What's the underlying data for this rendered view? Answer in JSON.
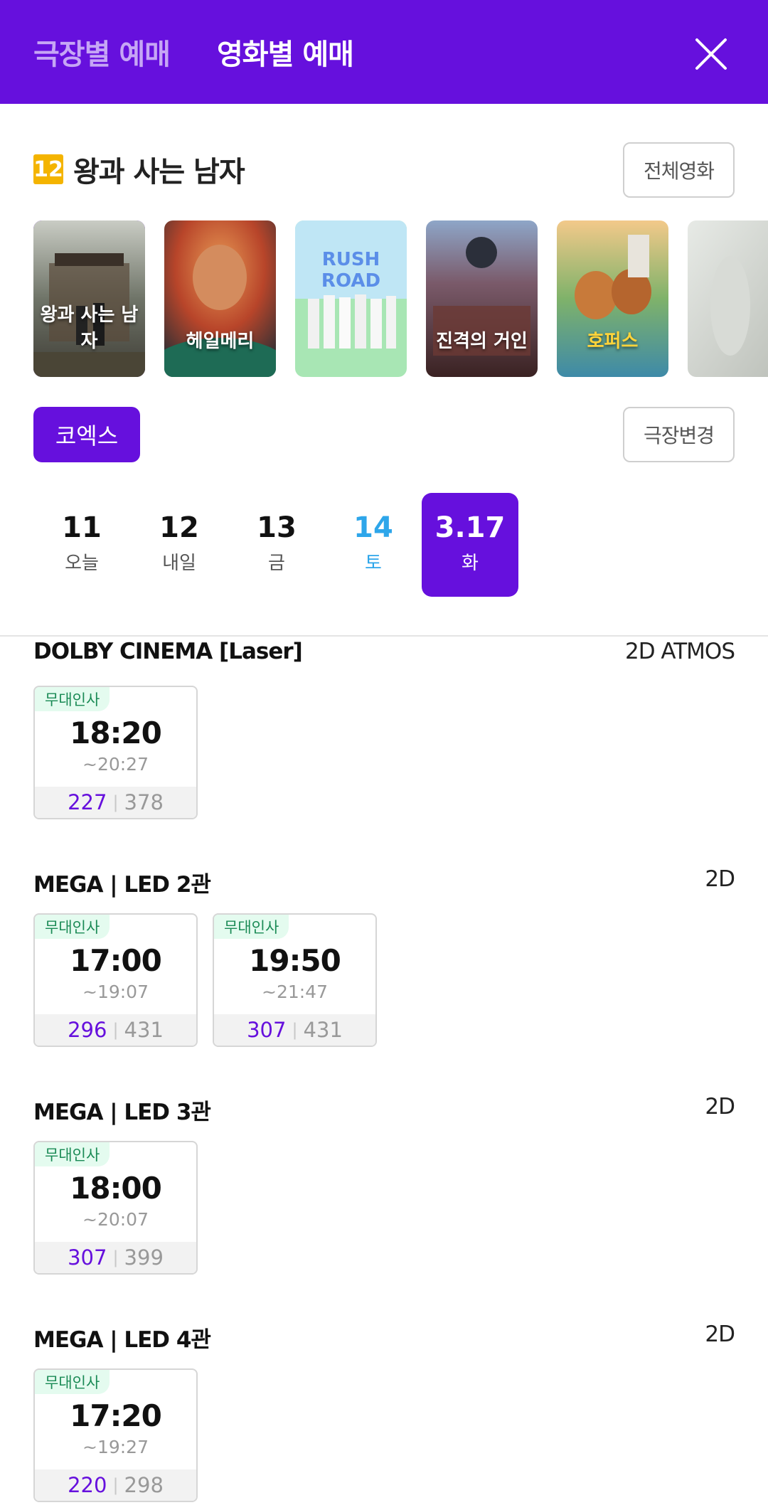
{
  "header": {
    "tab_theater": "극장별 예매",
    "tab_movie": "영화별 예매"
  },
  "movie": {
    "age_rating": "12",
    "title": "왕과 사는 남자",
    "all_movies_button": "전체영화"
  },
  "posters": [
    {
      "title": "왕과 사는 남자",
      "selected": true
    },
    {
      "title": "헤일메리"
    },
    {
      "title": "RUSH ROAD"
    },
    {
      "title": "진격의 거인"
    },
    {
      "title": "호퍼스"
    },
    {
      "title": ""
    }
  ],
  "theater": {
    "name": "코엑스",
    "change_button": "극장변경"
  },
  "dates": [
    {
      "num": "11",
      "dow": "오늘"
    },
    {
      "num": "12",
      "dow": "내일"
    },
    {
      "num": "13",
      "dow": "금"
    },
    {
      "num": "14",
      "dow": "토"
    },
    {
      "num": "3.17",
      "dow": "화",
      "selected": true
    }
  ],
  "halls": [
    {
      "name": "DOLBY CINEMA [Laser]",
      "format": "2D ATMOS",
      "shows": [
        {
          "tag": "무대인사",
          "start": "18:20",
          "end": "~20:27",
          "available": "227",
          "total": "378"
        }
      ]
    },
    {
      "name": "MEGA | LED 2관",
      "format": "2D",
      "shows": [
        {
          "tag": "무대인사",
          "start": "17:00",
          "end": "~19:07",
          "available": "296",
          "total": "431"
        },
        {
          "tag": "무대인사",
          "start": "19:50",
          "end": "~21:47",
          "available": "307",
          "total": "431"
        }
      ]
    },
    {
      "name": "MEGA | LED 3관",
      "format": "2D",
      "shows": [
        {
          "tag": "무대인사",
          "start": "18:00",
          "end": "~20:07",
          "available": "307",
          "total": "399"
        }
      ]
    },
    {
      "name": "MEGA | LED 4관",
      "format": "2D",
      "shows": [
        {
          "tag": "무대인사",
          "start": "17:20",
          "end": "~19:27",
          "available": "220",
          "total": "298"
        }
      ]
    }
  ],
  "seat_separator": "|",
  "colors": {
    "brand": "#6610dd",
    "saturday": "#2ea6ea",
    "tag_bg": "#e4fbef"
  },
  "icons": {
    "close": "close-icon"
  }
}
